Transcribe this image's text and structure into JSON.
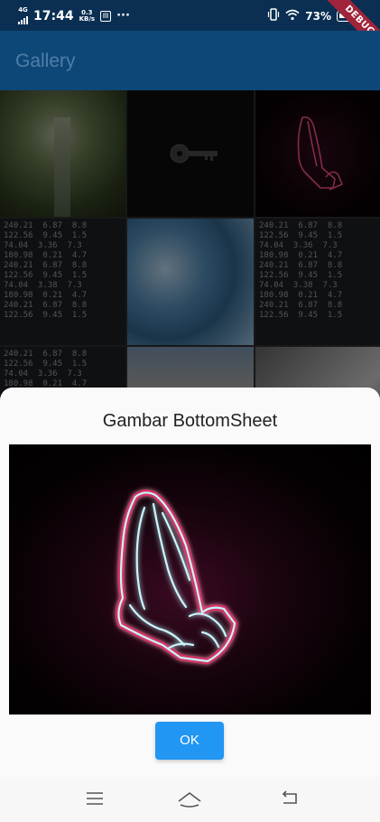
{
  "status_bar": {
    "network": "4G",
    "time": "17:44",
    "data_rate": "0.3",
    "data_unit": "KB/s",
    "dots": "···",
    "battery": "73%",
    "debug_banner": "DEBUG"
  },
  "app_bar": {
    "title": "Gallery"
  },
  "gallery": {
    "tiles": [
      {
        "name": "tree"
      },
      {
        "name": "key"
      },
      {
        "name": "praying-hands"
      },
      {
        "name": "stock-ticker"
      },
      {
        "name": "blue-marble"
      },
      {
        "name": "stock-ticker"
      },
      {
        "name": "stock-ticker"
      },
      {
        "name": "sunset-sky"
      },
      {
        "name": "sign"
      }
    ],
    "ticker_text": "240.21  6.87  8.8\n122.56  9.45  1.5\n74.04  3.36  7.3\n180.98  0.21  4.7\n240.21  6.87  8.8\n122.56  9.45  1.5\n74.04  3.38  7.3\n180.98  0.21  4.7\n240.21  6.87  8.8\n122.56  9.45  1.5"
  },
  "bottom_sheet": {
    "title": "Gambar BottomSheet",
    "ok_label": "OK"
  },
  "colors": {
    "app_bar": "#0d4777",
    "status_bar": "#0a2f52",
    "ok_button": "#2196f3",
    "neon_glow": "#e0175f",
    "neon_line": "#c8f6ff"
  },
  "nav_bar": {
    "icons": [
      "menu-icon",
      "home-icon",
      "back-icon"
    ]
  }
}
